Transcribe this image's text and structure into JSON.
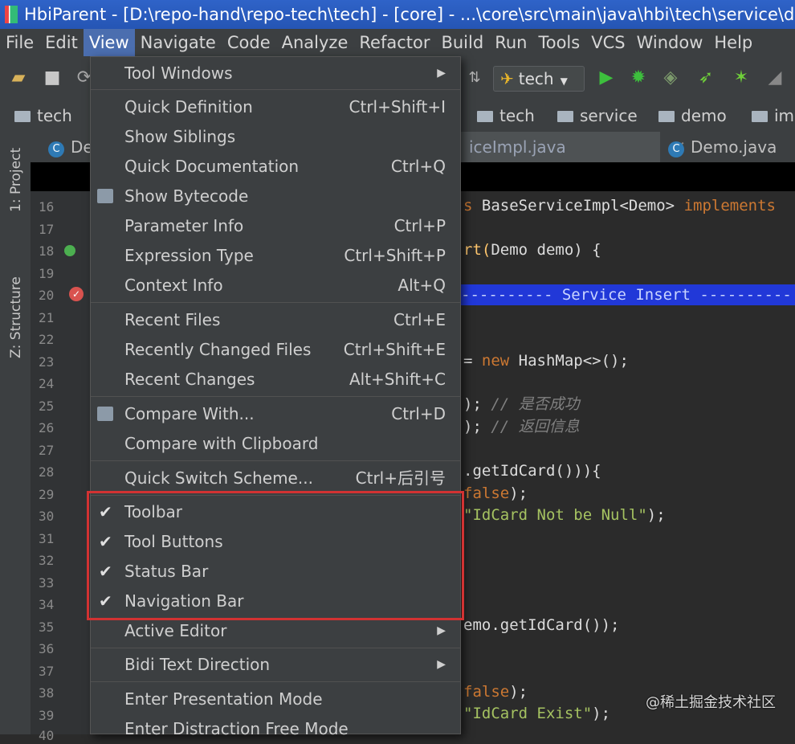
{
  "window": {
    "title": "HbiParent - [D:\\repo-hand\\repo-tech\\tech] - [core] - ...\\core\\src\\main\\java\\hbi\\tech\\service\\demo"
  },
  "menubar": {
    "items": [
      "File",
      "Edit",
      "View",
      "Navigate",
      "Code",
      "Analyze",
      "Refactor",
      "Build",
      "Run",
      "Tools",
      "VCS",
      "Window",
      "Help"
    ],
    "active": "View"
  },
  "toolbar": {
    "run_config": "tech"
  },
  "navbar": {
    "left": "tech",
    "crumbs": [
      "tech",
      "service",
      "demo",
      "im"
    ]
  },
  "sidepanel": {
    "project": "1: Project",
    "structure": "Z: Structure"
  },
  "tabs": {
    "left": "De",
    "middle": "iceImpl.java",
    "right": "Demo.java"
  },
  "editor": {
    "lines": [
      "16",
      "17",
      "18",
      "19",
      "20",
      "21",
      "22",
      "23",
      "24",
      "25",
      "26",
      "27",
      "28",
      "29",
      "30",
      "31",
      "32",
      "33",
      "34",
      "35",
      "36",
      "37",
      "38",
      "39",
      "40"
    ],
    "banner": "---------- Service Insert ----------",
    "code": {
      "l16_extends": "s ",
      "l16_base": "BaseServiceImpl<Demo> ",
      "l16_implements": "implements",
      "l18_a": "rt(",
      "l18_b": "Demo demo) {",
      "l23_a": "= ",
      "l23_new": "new",
      "l23_b": " HashMap<>();",
      "l25_a": "); ",
      "l25_comment": "// 是否成功",
      "l26_a": "); ",
      "l26_comment": "// 返回信息",
      "l28": ".getIdCard())){",
      "l29_kw": "false",
      "l29_b": ");",
      "l30_str": "\"IdCard Not be Null\"",
      "l30_b": ");",
      "l35": "emo.getIdCard());",
      "l38_kw": "false",
      "l38_b": ");",
      "l39_str": "\"IdCard Exist\"",
      "l39_b": ");"
    }
  },
  "view_menu": {
    "items": [
      {
        "label": "Tool Windows"
      },
      {
        "label": "Quick Definition",
        "shortcut": "Ctrl+Shift+I"
      },
      {
        "label": "Show Siblings"
      },
      {
        "label": "Quick Documentation",
        "shortcut": "Ctrl+Q"
      },
      {
        "label": "Show Bytecode"
      },
      {
        "label": "Parameter Info",
        "shortcut": "Ctrl+P"
      },
      {
        "label": "Expression Type",
        "shortcut": "Ctrl+Shift+P"
      },
      {
        "label": "Context Info",
        "shortcut": "Alt+Q"
      },
      {
        "label": "Recent Files",
        "shortcut": "Ctrl+E"
      },
      {
        "label": "Recently Changed Files",
        "shortcut": "Ctrl+Shift+E"
      },
      {
        "label": "Recent Changes",
        "shortcut": "Alt+Shift+C"
      },
      {
        "label": "Compare With...",
        "shortcut": "Ctrl+D"
      },
      {
        "label": "Compare with Clipboard"
      },
      {
        "label": "Quick Switch Scheme...",
        "shortcut": "Ctrl+后引号"
      },
      {
        "label": "Toolbar",
        "checked": true
      },
      {
        "label": "Tool Buttons",
        "checked": true
      },
      {
        "label": "Status Bar",
        "checked": true
      },
      {
        "label": "Navigation Bar",
        "checked": true
      },
      {
        "label": "Active Editor"
      },
      {
        "label": "Bidi Text Direction"
      },
      {
        "label": "Enter Presentation Mode"
      },
      {
        "label": "Enter Distraction Free Mode"
      }
    ],
    "check_glyph": "✔"
  },
  "watermark": "@稀土掘金技术社区"
}
